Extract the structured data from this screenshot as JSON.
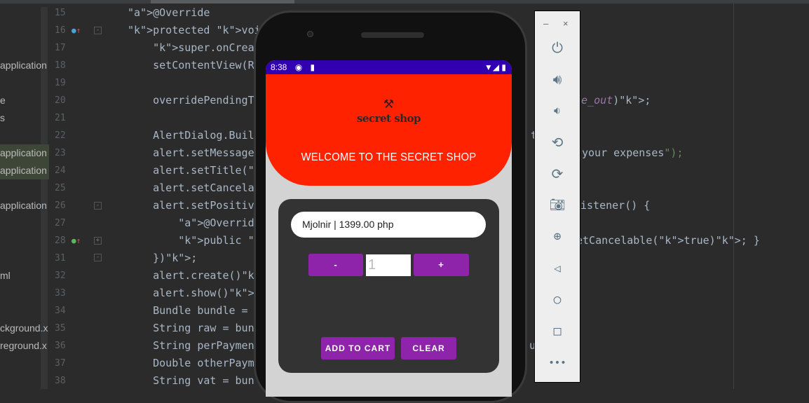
{
  "project_panel": {
    "items": [
      {
        "label": "application",
        "line": 18
      },
      {
        "label": "e",
        "line": 20
      },
      {
        "label": "s",
        "line": 21
      },
      {
        "label": "application",
        "line": 23,
        "selected": true
      },
      {
        "label": "application",
        "line": 24,
        "selected": true
      },
      {
        "label": "application",
        "line": 26
      },
      {
        "label": "ml",
        "line": 32
      },
      {
        "label": "ckground.x",
        "line": 35
      },
      {
        "label": "reground.x",
        "line": 36
      }
    ]
  },
  "editor": {
    "lines": [
      {
        "n": "15",
        "code": "@Override"
      },
      {
        "n": "16",
        "code": "protected void onCre"
      },
      {
        "n": "17",
        "code": "    super.onCreate(s"
      },
      {
        "n": "18",
        "code": "    setContentView(R"
      },
      {
        "n": "19",
        "code": ""
      },
      {
        "n": "20",
        "code": "    overridePendingT",
        "right": "le_out);"
      },
      {
        "n": "21",
        "code": ""
      },
      {
        "n": "22",
        "code": "    AlertDialog.Buil",
        "right": "t"
      },
      {
        "n": "23",
        "code": "    alert.setMessage",
        "right": "your expenses\");"
      },
      {
        "n": "24",
        "code": "    alert.setTitle(\""
      },
      {
        "n": "25",
        "code": "    alert.setCancela"
      },
      {
        "n": "26",
        "code": "    alert.setPositiv",
        "right": "istener() {"
      },
      {
        "n": "27",
        "code": "        @Override"
      },
      {
        "n": "28",
        "code": "        public void ",
        "right": "etCancelable(true); }"
      },
      {
        "n": "31",
        "code": "    });"
      },
      {
        "n": "32",
        "code": "    alert.create();"
      },
      {
        "n": "33",
        "code": "    alert.show();"
      },
      {
        "n": "34",
        "code": "    Bundle bundle = "
      },
      {
        "n": "35",
        "code": "    String raw = bun"
      },
      {
        "n": "36",
        "code": "    String perPaymen",
        "right": "u"
      },
      {
        "n": "37",
        "code": "    Double otherPaym"
      },
      {
        "n": "38",
        "code": "    String vat = bun"
      }
    ]
  },
  "phone": {
    "status": {
      "time": "8:38",
      "icons": [
        "pause-icon",
        "sd-card-icon"
      ],
      "right_icons": [
        "wifi-icon",
        "signal-icon",
        "battery-icon"
      ]
    },
    "logo_text": "secret shop",
    "welcome": "WELCOME TO THE SECRET SHOP",
    "product": "Mjolnir | 1399.00 php",
    "minus": "-",
    "plus": "+",
    "quantity": "1",
    "add_to_cart": "ADD TO CART",
    "clear": "CLEAR",
    "colors": {
      "status": "#3100b0",
      "header": "#ff2200",
      "button": "#8e24aa",
      "card": "#333333"
    }
  },
  "emulator_toolbar": {
    "minimize": "–",
    "close": "×",
    "buttons": [
      "power-icon",
      "volume-up-icon",
      "volume-down-icon",
      "rotate-left-icon",
      "rotate-right-icon",
      "camera-icon",
      "zoom-icon",
      "back-icon",
      "home-icon",
      "overview-icon",
      "more-icon"
    ]
  }
}
